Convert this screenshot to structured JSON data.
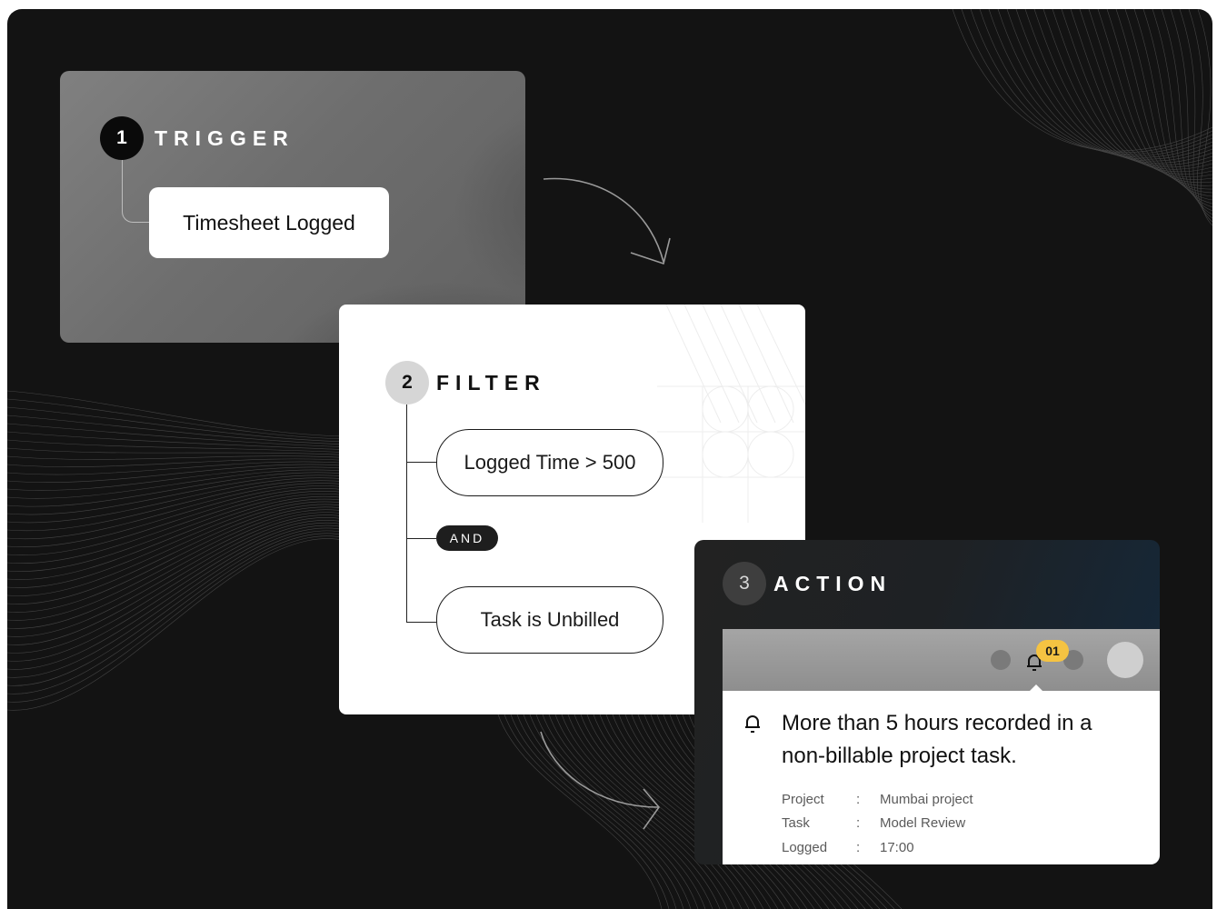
{
  "trigger": {
    "number": "1",
    "title": "TRIGGER",
    "event": "Timesheet Logged"
  },
  "filter": {
    "number": "2",
    "title": "FILTER",
    "conditions": [
      "Logged Time > 500",
      "Task is Unbilled"
    ],
    "operator": "AND"
  },
  "action": {
    "number": "3",
    "title": "ACTION",
    "notification": {
      "badge": "01",
      "icon": "bell-icon",
      "message": "More than 5 hours recorded in a non-billable project task.",
      "details": [
        {
          "label": "Project",
          "sep": ":",
          "value": "Mumbai project"
        },
        {
          "label": "Task",
          "sep": ":",
          "value": "Model Review"
        },
        {
          "label": "Logged",
          "sep": ":",
          "value": "17:00"
        }
      ]
    }
  },
  "colors": {
    "background": "#131313",
    "badge": "#f5c342",
    "action_gradient_end": "#13293d"
  }
}
